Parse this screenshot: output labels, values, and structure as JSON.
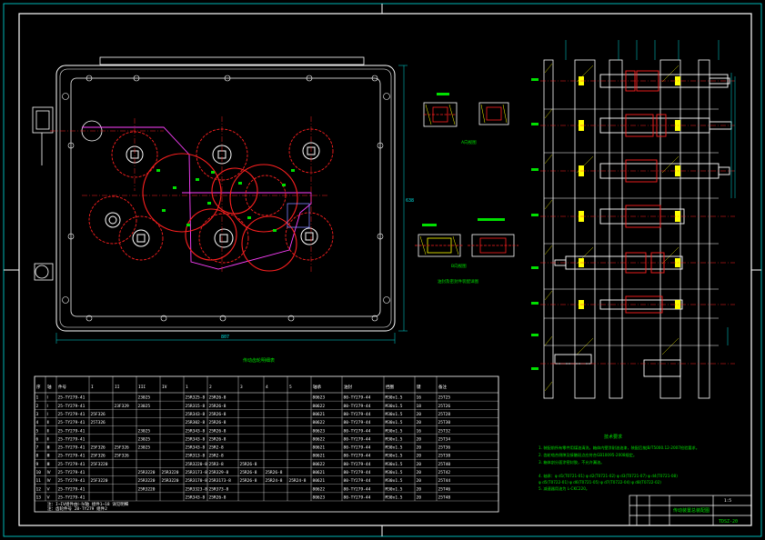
{
  "drawing": {
    "number": "TDSZ-20",
    "table_title": "传动齿轮明细表",
    "notes_title": "技术要求",
    "plan_dim_width": "807",
    "plan_dim_height": "638",
    "section_label_a": "A-A",
    "section_label_b": "B-B",
    "section_label_c": "C-C",
    "detail_caption_1": "A向视图",
    "detail_caption_2": "B向视图",
    "detail_caption_3": "油封及密封件装配详图"
  },
  "table": {
    "headers": [
      "序",
      "轴",
      "件号",
      "I",
      "II",
      "III",
      "IV",
      "1",
      "2",
      "3",
      "4",
      "5",
      "轴承",
      "油封",
      "挡圈",
      "键",
      "备注"
    ],
    "rows": [
      [
        "1",
        "Ⅰ",
        "25-TY279-41",
        "",
        "",
        "23025",
        "",
        "25R325-8",
        "25R26-8",
        "",
        "",
        "",
        "80623",
        "80-TY279-44",
        "M30x1.5",
        "16",
        "25T25"
      ],
      [
        "2",
        "Ⅰ",
        "25-TY279-41",
        "",
        "23F329",
        "23025",
        "",
        "25R315-8",
        "25R26-8",
        "",
        "",
        "",
        "80622",
        "80-TY279-44",
        "M30x1.5",
        "18",
        "25T26"
      ],
      [
        "3",
        "Ⅰ",
        "25-TY279-41",
        "25F326",
        "",
        "",
        "",
        "25R343-8",
        "25R26-8",
        "",
        "",
        "",
        "80621",
        "80-TY279-44",
        "M30x1.5",
        "20",
        "25T28"
      ],
      [
        "4",
        "Ⅱ",
        "25-TY279-41",
        "25T326",
        "",
        "",
        "",
        "25R302-8",
        "25R26-8",
        "",
        "",
        "",
        "80622",
        "80-TY279-44",
        "M30x1.5",
        "20",
        "25T30"
      ],
      [
        "5",
        "Ⅱ",
        "25-TY279-41",
        "",
        "",
        "23025",
        "",
        "25R343-8",
        "25R26-8",
        "",
        "",
        "",
        "80623",
        "80-TY279-44",
        "M30x1.5",
        "16",
        "25T32"
      ],
      [
        "6",
        "Ⅱ",
        "25-TY279-41",
        "",
        "",
        "23025",
        "",
        "25R343-8",
        "25R26-8",
        "",
        "",
        "",
        "80622",
        "80-TY279-44",
        "M30x1.5",
        "20",
        "25T34"
      ],
      [
        "7",
        "Ⅲ",
        "25-TY279-41",
        "25F326",
        "25F326",
        "23025",
        "",
        "25R343-8",
        "25R2-8",
        "",
        "",
        "",
        "80621",
        "80-TY279-44",
        "M30x1.5",
        "20",
        "25T36"
      ],
      [
        "8",
        "Ⅲ",
        "25-TY279-41",
        "25F326",
        "25F326",
        "",
        "",
        "25R313-8",
        "25R2-8",
        "",
        "",
        "",
        "80621",
        "80-TY279-44",
        "M30x1.5",
        "20",
        "25T38"
      ],
      [
        "9",
        "Ⅲ",
        "25-TY279-41",
        "25F3220",
        "",
        "",
        "",
        "25R3220-8",
        "25R3-8",
        "25R26-8",
        "",
        "",
        "80622",
        "80-TY279-44",
        "M30x1.5",
        "20",
        "25T40"
      ],
      [
        "10",
        "Ⅳ",
        "25-TY279-41",
        "",
        "",
        "25R3220",
        "25R3220",
        "25R3173-8",
        "25R329-8",
        "25R26-8",
        "25R26-8",
        "",
        "80621",
        "80-TY279-44",
        "M30x1.5",
        "20",
        "25T42"
      ],
      [
        "11",
        "Ⅳ",
        "25-TY279-41",
        "25F3220",
        "",
        "25R3220",
        "25R3220",
        "25R3170-8",
        "25R3173-8",
        "25R26-8",
        "25R24-8",
        "25R24-8",
        "80621",
        "80-TY279-44",
        "M30x1.5",
        "20",
        "25T44"
      ],
      [
        "12",
        "Ⅴ",
        "25-TY279-41",
        "",
        "",
        "25R3220",
        "",
        "25R3323-8",
        "25R373-8",
        "",
        "",
        "",
        "80622",
        "80-TY279-44",
        "M30x1.5",
        "20",
        "25T46"
      ],
      [
        "13",
        "Ⅴ",
        "25-TY279-41",
        "",
        "",
        "",
        "",
        "25R343-8",
        "25R26-8",
        "",
        "",
        "",
        "80623",
        "80-TY279-44",
        "M30x1.5",
        "20",
        "25T48"
      ]
    ],
    "footer_1": "注：I~IV组件由Ⅰ-Ⅳ轴 组件1~18 详见明细",
    "footer_2": "注：齿轮件号 28-TY279 组件2"
  },
  "notes": {
    "lines": [
      "1. 装配前所有零件用煤油清洗，箱体内壁涂耐油油漆，装配后按JB/T5000.12-2007检验要求。",
      "2. 齿轮啮合侧隙及接触斑点应符合GB10095-2008规定。",
      "3. 箱体剖分面涂密封胶，不允许漏油。",
      "4. 轴承：φ d1(T0721-01)  φ d2(T0721-02)  φ d3(T0721-07)  φ d4(T0721-08)",
      "         φ d5(T0722-01)  φ d6(T0721-05)  φ d7(T0722-04)  φ d8(T0722-02)",
      "5. 减速器用油为 L-CKC220。"
    ]
  },
  "title_block": {
    "title": "传动装置总装配图",
    "number": "TDSZ-20",
    "scale": "1:5"
  },
  "colors": {
    "border": "#ffffff",
    "housing": "#ffffff",
    "gear": "#ff2020",
    "magenta": "#ff40ff",
    "green": "#00e000",
    "cyan": "#00e0e0",
    "yellow": "#ffff00"
  }
}
